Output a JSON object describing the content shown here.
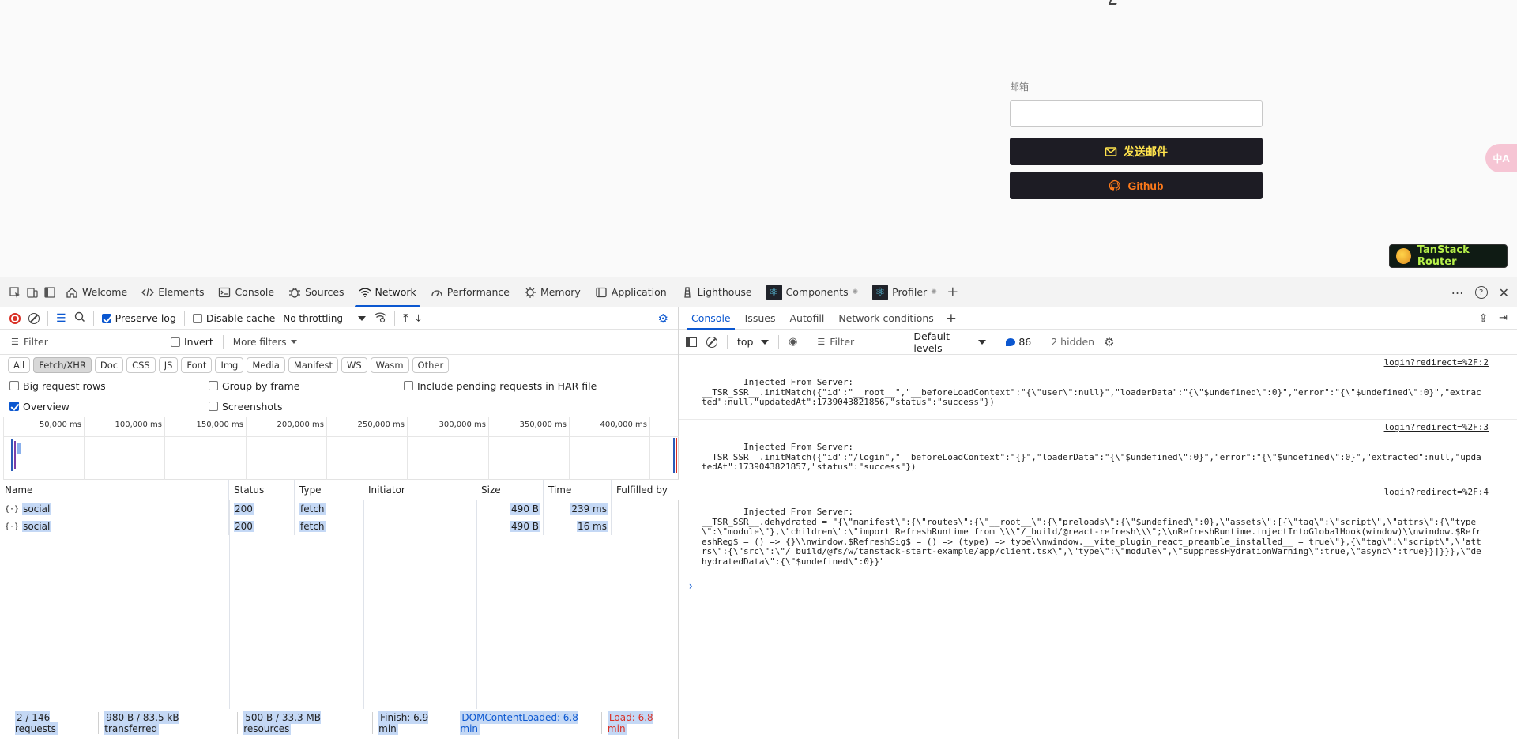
{
  "page": {
    "email_label": "邮箱",
    "email_value": "",
    "send_button": "发送邮件",
    "github_button": "Github",
    "translate_label": "中A",
    "tanstack_label": "TanStack Router",
    "colors": {
      "button_bg": "#1d1c24",
      "send_text": "#ffe34d",
      "github_text": "#ff7a1a",
      "tanstack_text": "#b6f04a"
    }
  },
  "devtools": {
    "tabs": [
      "Welcome",
      "Elements",
      "Console",
      "Sources",
      "Network",
      "Performance",
      "Memory",
      "Application",
      "Lighthouse",
      "Components",
      "Profiler"
    ],
    "active_tab": "Network",
    "network": {
      "preserve_log": "Preserve log",
      "disable_cache": "Disable cache",
      "throttling": "No throttling",
      "filter_placeholder": "Filter",
      "invert": "Invert",
      "more_filters": "More filters",
      "types": [
        "All",
        "Fetch/XHR",
        "Doc",
        "CSS",
        "JS",
        "Font",
        "Img",
        "Media",
        "Manifest",
        "WS",
        "Wasm",
        "Other"
      ],
      "active_type": "Fetch/XHR",
      "options": {
        "big_request_rows": "Big request rows",
        "group_by_frame": "Group by frame",
        "include_pending": "Include pending requests in HAR file",
        "overview": "Overview",
        "screenshots": "Screenshots"
      },
      "timeline_ticks": [
        "50,000 ms",
        "100,000 ms",
        "150,000 ms",
        "200,000 ms",
        "250,000 ms",
        "300,000 ms",
        "350,000 ms",
        "400,000 ms"
      ],
      "columns": [
        "Name",
        "Status",
        "Type",
        "Initiator",
        "Size",
        "Time",
        "Fulfilled by"
      ],
      "rows": [
        {
          "name": "social",
          "status": "200",
          "type": "fetch",
          "initiator": "",
          "size": "490 B",
          "time": "239 ms",
          "fulfilled": ""
        },
        {
          "name": "social",
          "status": "200",
          "type": "fetch",
          "initiator": "",
          "size": "490 B",
          "time": "16 ms",
          "fulfilled": ""
        }
      ],
      "status": {
        "requests": "2 / 146 requests",
        "transferred": "980 B / 83.5 kB transferred",
        "resources": "500 B / 33.3 MB resources",
        "finish": "Finish: 6.9 min",
        "dcl": "DOMContentLoaded: 6.8 min",
        "load": "Load: 6.8 min"
      }
    },
    "console": {
      "tabs": [
        "Console",
        "Issues",
        "Autofill",
        "Network conditions"
      ],
      "active_tab": "Console",
      "context": "top",
      "filter_placeholder": "Filter",
      "levels": "Default levels",
      "message_count": "86",
      "hidden": "2 hidden",
      "entries": [
        {
          "text": "Injected From Server:\n__TSR_SSR__.initMatch({\"id\":\"__root__\",\"__beforeLoadContext\":\"{\\\"user\\\":null}\",\"loaderData\":\"{\\\"$undefined\\\":0}\",\"error\":\"{\\\"$undefined\\\":0}\",\"extracted\":null,\"updatedAt\":1739043821856,\"status\":\"success\"})",
          "source": "login?redirect=%2F:2"
        },
        {
          "text": "Injected From Server:\n__TSR_SSR__.initMatch({\"id\":\"/login\",\"__beforeLoadContext\":\"{}\",\"loaderData\":\"{\\\"$undefined\\\":0}\",\"error\":\"{\\\"$undefined\\\":0}\",\"extracted\":null,\"updatedAt\":1739043821857,\"status\":\"success\"})",
          "source": "login?redirect=%2F:3"
        },
        {
          "text": "Injected From Server:\n__TSR_SSR__.dehydrated = \"{\\\"manifest\\\":{\\\"routes\\\":{\\\"__root__\\\":{\\\"preloads\\\":{\\\"$undefined\\\":0},\\\"assets\\\":[{\\\"tag\\\":\\\"script\\\",\\\"attrs\\\":{\\\"type\\\":\\\"module\\\"},\\\"children\\\":\\\"import RefreshRuntime from \\\\\\\"/_build/@react-refresh\\\\\\\";\\\\nRefreshRuntime.injectIntoGlobalHook(window)\\\\nwindow.$RefreshReg$ = () => {}\\\\nwindow.$RefreshSig$ = () => (type) => type\\\\nwindow.__vite_plugin_react_preamble_installed__ = true\\\"},{\\\"tag\\\":\\\"script\\\",\\\"attrs\\\":{\\\"src\\\":\\\"/_build/@fs/w/tanstack-start-example/app/client.tsx\\\",\\\"type\\\":\\\"module\\\",\\\"suppressHydrationWarning\\\":true,\\\"async\\\":true}}]}}},\\\"dehydratedData\\\":{\\\"$undefined\\\":0}}\"",
          "source": "login?redirect=%2F:4"
        }
      ]
    }
  }
}
